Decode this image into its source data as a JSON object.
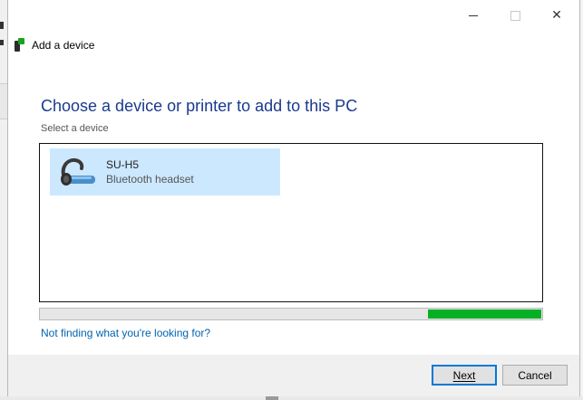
{
  "window": {
    "title": "Add a device",
    "controls": {
      "minimize": "minimize",
      "maximize": "maximize",
      "close": "✕"
    }
  },
  "main": {
    "heading": "Choose a device or printer to add to this PC",
    "subheading": "Select a device",
    "devices": [
      {
        "name": "SU-H5",
        "type": "Bluetooth headset",
        "icon": "bluetooth-headset-icon",
        "selected": true
      }
    ],
    "progress_fraction": 0.23,
    "help_link": "Not finding what you're looking for?"
  },
  "footer": {
    "next_label": "Next",
    "cancel_label": "Cancel"
  },
  "colors": {
    "heading": "#1a3a8f",
    "selection": "#cce8ff",
    "progress": "#06b025",
    "link": "#0063b1",
    "default_button_border": "#0078d7"
  }
}
